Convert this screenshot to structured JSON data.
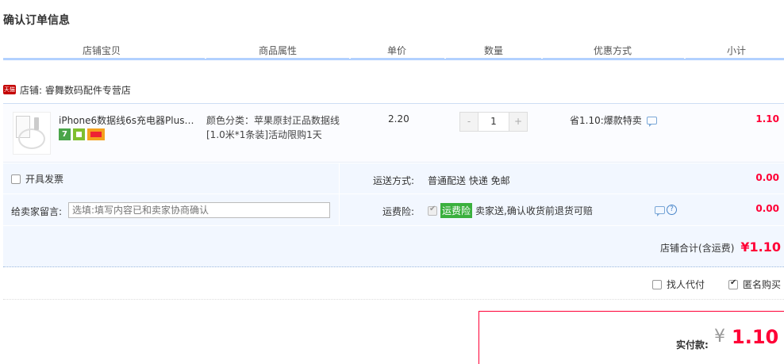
{
  "page": {
    "title": "确认订单信息"
  },
  "columns": [
    "店铺宝贝",
    "商品属性",
    "单价",
    "数量",
    "优惠方式",
    "小计"
  ],
  "shop": {
    "badge": "天猫",
    "name": "店铺: 睿舞数码配件专营店"
  },
  "item": {
    "name": "iPhone6数据线6s充电器Plus手…",
    "attr": "颜色分类：苹果原封正品数据线[1.0米*1条装]活动限购1天",
    "price": "2.20",
    "qty_minus": "-",
    "qty": "1",
    "qty_plus": "+",
    "promo": "省1.10:爆款特卖",
    "subtotal": "1.10",
    "icon_7": "7"
  },
  "options": {
    "invoice_label": "开具发票",
    "shipping_label": "运送方式:",
    "shipping_value": "普通配送 快递 免邮",
    "shipping_fee": "0.00",
    "message_label": "给卖家留言:",
    "message_placeholder": "选填:填写内容已和卖家协商确认",
    "insurance_label": "运费险:",
    "insurance_badge": "运费险",
    "insurance_text": "卖家送,确认收货前退货可赔",
    "insurance_fee": "0.00",
    "help_icon": "?"
  },
  "shop_total": {
    "label": "店铺合计(含运费)",
    "amount": "¥1.10"
  },
  "extras": {
    "proxy_label": "找人代付",
    "anon_label": "匿名购买"
  },
  "payment": {
    "label": "实付款:",
    "currency": "¥",
    "amount": "1.10"
  },
  "colors": {
    "accent": "#ff0036",
    "header_rule": "#b2d1ff",
    "panel_bg": "#f2f7ff",
    "badge_green": "#3ab03e"
  }
}
